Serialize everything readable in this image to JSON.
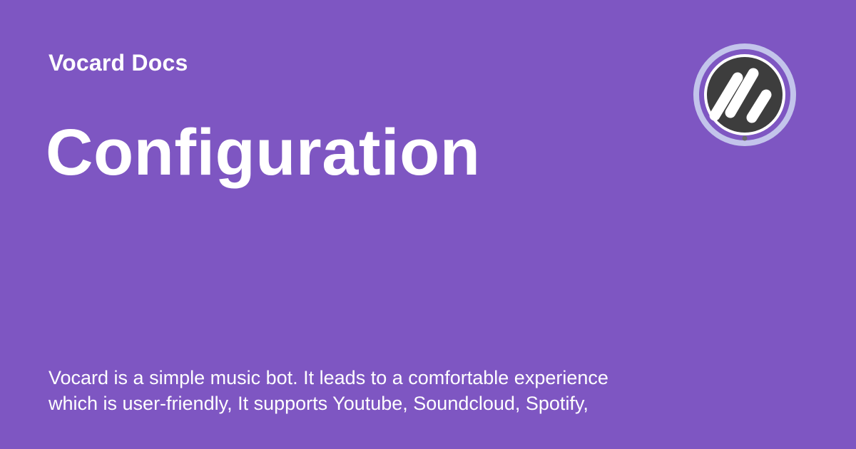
{
  "site": {
    "name": "Vocard Docs"
  },
  "page": {
    "title": "Configuration"
  },
  "description": {
    "lines": [
      "Vocard is a simple music bot. It leads to a comfortable experience",
      "which is user-friendly, It supports Youtube, Soundcloud, Spotify,"
    ]
  },
  "logo": {
    "icon": "vocard-logo-icon"
  },
  "colors": {
    "background": "#7e56c2",
    "text": "#ffffff",
    "logo_ring": "#c3c4eb",
    "logo_disc": "#3d3d3d",
    "logo_dot": "#6b6b6b"
  }
}
